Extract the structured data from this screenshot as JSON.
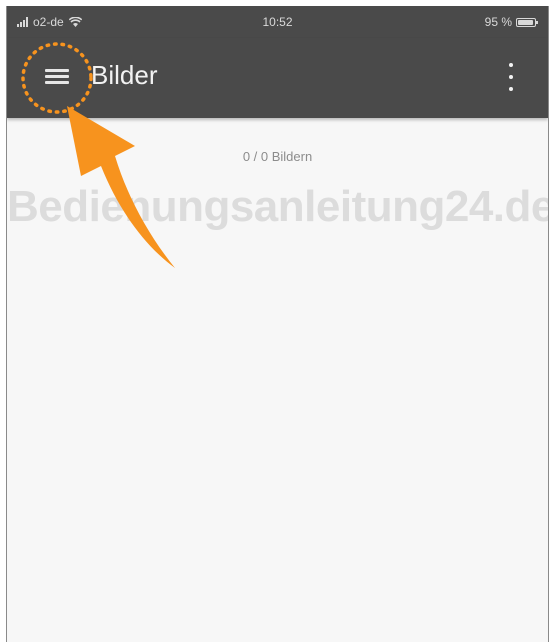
{
  "status_bar": {
    "carrier": "o2-de",
    "time": "10:52",
    "battery": "95 %",
    "battery_level": 0.95
  },
  "app_bar": {
    "title": "Bilder",
    "menu_icon": "hamburger-menu-icon",
    "more_icon": "more-vertical-icon"
  },
  "content": {
    "counter_text": "0 / 0 Bildern"
  },
  "watermark": "Bedienungsanleitung24.de",
  "colors": {
    "app_bar": "#4a4a4a",
    "background": "#f7f7f7",
    "annotation": "#f7931e"
  }
}
